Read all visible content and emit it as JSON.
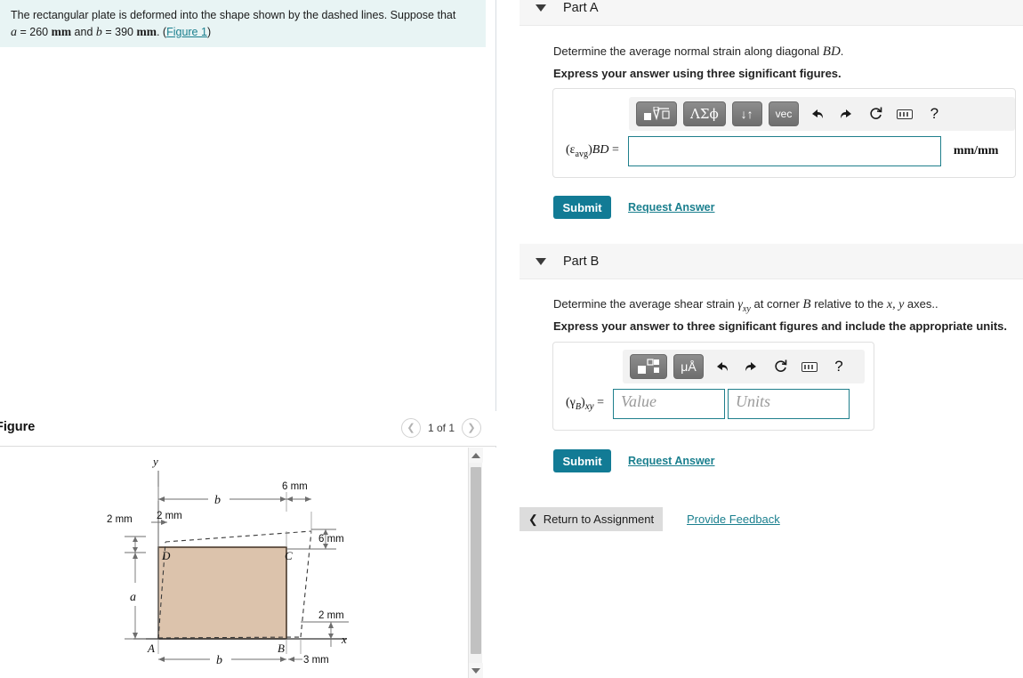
{
  "question": {
    "line1": "The rectangular plate is deformed into the shape shown by the dashed lines. Suppose that",
    "a_label": "a",
    "a_eq": " = 260 ",
    "a_unit": "mm",
    "and": " and ",
    "b_label": "b",
    "b_eq": " = 390 ",
    "b_unit": "mm",
    "period": ". (",
    "figure_link": "Figure 1",
    "close": ")"
  },
  "figure_panel": {
    "title": "Figure",
    "pager": {
      "prev_icon": "chevron-left-icon",
      "next_icon": "chevron-right-icon",
      "label": "1 of 1"
    },
    "scrollbar": {
      "up_icon": "triangle-up-icon",
      "down_icon": "triangle-down-icon"
    }
  },
  "figure_diagram": {
    "axis_x": "x",
    "axis_y": "y",
    "vertices": {
      "A": "A",
      "B": "B",
      "C": "C",
      "D": "D"
    },
    "dim_a": "a",
    "dim_b_top": "b",
    "dim_b_bottom": "b",
    "dim_left_2mm": "2 mm",
    "dim_top_2mm": "2 mm",
    "dim_top_6mm": "6 mm",
    "dim_right_6mm": "6 mm",
    "dim_right_2mm": "2 mm",
    "dim_bottom_3mm": "3 mm",
    "plate_fill": "#dcc3ac",
    "plate_stroke": "#4a3a2c"
  },
  "parts": [
    {
      "id": "a",
      "header_title": "Part A",
      "caret_icon": "caret-down-icon",
      "prompt_prefix": "Determine the average normal strain along diagonal ",
      "prompt_math": "BD",
      "prompt_suffix": ".",
      "instruction": "Express your answer using three significant figures.",
      "toolbar": [
        {
          "name": "template-math-button",
          "label": "■√□",
          "style": "dark"
        },
        {
          "name": "greek-symbols-button",
          "label": "ΛΣϕ",
          "style": "dark"
        },
        {
          "name": "sort-arrows-button",
          "label": "↓↑",
          "style": "dark"
        },
        {
          "name": "vector-button",
          "label": "vec",
          "style": "dark"
        },
        {
          "name": "undo-button",
          "label": "↶",
          "style": "plain"
        },
        {
          "name": "redo-button",
          "label": "↷",
          "style": "plain"
        },
        {
          "name": "reset-button",
          "label": "↺",
          "style": "plain"
        },
        {
          "name": "keyboard-button",
          "label": "keyboard",
          "style": "kbd"
        },
        {
          "name": "help-button",
          "label": "?",
          "style": "help"
        }
      ],
      "answer_label_html": "(εavg)BD =",
      "answer_value": "",
      "answer_placeholder": "",
      "unit_suffix": "mm/mm",
      "submit_label": "Submit",
      "request_label": "Request Answer"
    },
    {
      "id": "b",
      "header_title": "Part B",
      "caret_icon": "caret-down-icon",
      "prompt_prefix": "Determine the average shear strain ",
      "prompt_math": "γxy",
      "prompt_mid": " at corner ",
      "prompt_corner": "B",
      "prompt_mid2": " relative to the ",
      "prompt_axes": "x, y",
      "prompt_suffix": " axes..",
      "instruction": "Express your answer to three significant figures and include the appropriate units.",
      "toolbar": [
        {
          "name": "template-math-button",
          "label": "■□",
          "style": "dark"
        },
        {
          "name": "units-button",
          "label": "μÅ",
          "style": "dark"
        },
        {
          "name": "undo-button",
          "label": "↶",
          "style": "plain"
        },
        {
          "name": "redo-button",
          "label": "↷",
          "style": "plain"
        },
        {
          "name": "reset-button",
          "label": "↺",
          "style": "plain"
        },
        {
          "name": "keyboard-button",
          "label": "keyboard",
          "style": "kbd"
        },
        {
          "name": "help-button",
          "label": "?",
          "style": "help"
        }
      ],
      "answer_label_html": "(γB)xy =",
      "value_placeholder": "Value",
      "units_placeholder": "Units",
      "submit_label": "Submit",
      "request_label": "Request Answer"
    }
  ],
  "footer": {
    "return_icon": "chevron-left-icon",
    "return_label": "Return to Assignment",
    "feedback_label": "Provide Feedback"
  },
  "colors": {
    "accent": "#127b95",
    "link": "#1a7f8e",
    "question_bg": "#e8f4f4",
    "part_header_bg": "#f6f6f6",
    "input_border": "#1f7f8c"
  }
}
